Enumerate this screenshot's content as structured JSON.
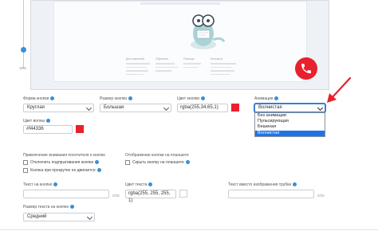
{
  "preview": {
    "slider_value": "10%",
    "footer_columns": [
      "Для компаний",
      "Обучение",
      "Помощь",
      "Контакты"
    ]
  },
  "shape": {
    "label": "Форма кнопки",
    "value": "Круглая"
  },
  "size": {
    "label": "Размер кнопки",
    "value": "Большая"
  },
  "color": {
    "label": "Цвет кнопки",
    "value": "rgba(255,34,65,1)",
    "swatch": "#e8212e"
  },
  "animation": {
    "label": "Анимация",
    "value": "Волнистая",
    "options": [
      "Без анимации",
      "Пульсирующая",
      "Бешеная",
      "Волнистая"
    ]
  },
  "wave": {
    "label": "Цвет волны",
    "value": "#f44336",
    "swatch": "#e8212e"
  },
  "attention": {
    "label": "Привлечение внимания посетителя к кнопке",
    "opt1": "Отключить подпрыгивания кнопки",
    "opt2": "Кнопка при прокрутке не двигается"
  },
  "tablet": {
    "label": "Отображение кнопки на планшете",
    "opt1": "Скрыть кнопку на планшете"
  },
  "btn_text": {
    "label": "Текст на кнопке",
    "value": "",
    "count": "0/25"
  },
  "text_color": {
    "label": "Цвет текста",
    "value": "rgba(255, 255, 255, 1)"
  },
  "alt_text": {
    "label": "Текст вместо изображения трубки",
    "value": "",
    "count": "0/25"
  },
  "text_size": {
    "label": "Размер текста на кнопке",
    "value": "Средний"
  },
  "accent": "#e8212e"
}
